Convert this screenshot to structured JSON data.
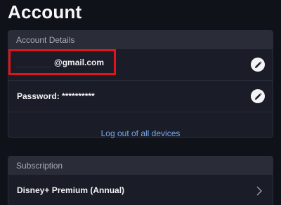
{
  "header": {
    "title": "Account"
  },
  "account_details": {
    "section_label": "Account Details",
    "email": {
      "visible_text": "@gmail.com",
      "edit_icon": "pencil-icon"
    },
    "password": {
      "label": "Password: **********",
      "edit_icon": "pencil-icon"
    },
    "logout_all_label": "Log out of all devices"
  },
  "subscription": {
    "section_label": "Subscription",
    "plan_label": "Disney+ Premium (Annual)",
    "chevron_icon": "chevron-right-icon"
  },
  "colors": {
    "background": "#101219",
    "card": "#1a1d28",
    "card_header": "#2a2d38",
    "link": "#78a9ea",
    "highlight": "#e2141b"
  }
}
